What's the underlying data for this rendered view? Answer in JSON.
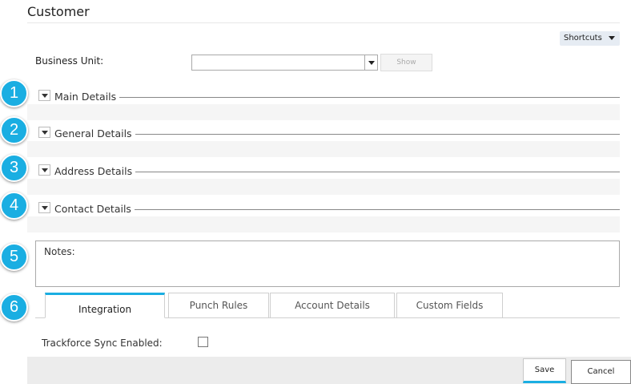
{
  "page": {
    "title": "Customer"
  },
  "toolbar": {
    "shortcuts_label": "Shortcuts"
  },
  "business_unit": {
    "label": "Business Unit:",
    "value": "",
    "show_label": "Show"
  },
  "sections": [
    {
      "number": "1",
      "label": "Main Details"
    },
    {
      "number": "2",
      "label": "General Details"
    },
    {
      "number": "3",
      "label": "Address Details"
    },
    {
      "number": "4",
      "label": "Contact Details"
    }
  ],
  "notes": {
    "number": "5",
    "label": "Notes:"
  },
  "tabs": {
    "number": "6",
    "items": [
      {
        "label": "Integration",
        "active": true
      },
      {
        "label": "Punch Rules",
        "active": false
      },
      {
        "label": "Account Details",
        "active": false
      },
      {
        "label": "Custom Fields",
        "active": false
      }
    ]
  },
  "integration": {
    "sync_label": "Trackforce Sync Enabled:",
    "sync_enabled": false
  },
  "actions": {
    "save_label": "Save",
    "cancel_label": "Cancel"
  },
  "colors": {
    "accent": "#1aaee2",
    "footer": "#ececec",
    "section_bg": "#f5f5f5"
  }
}
